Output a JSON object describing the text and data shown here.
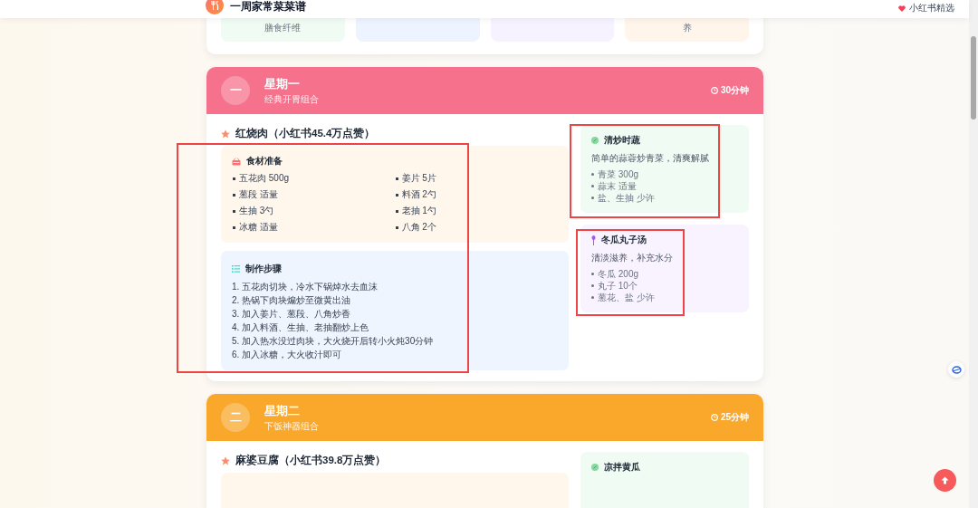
{
  "header": {
    "title": "一周家常菜菜谱",
    "badge": "小红书精选"
  },
  "summary_cards": [
    {
      "text": "膳食纤维",
      "color": "#effbf3"
    },
    {
      "color": "#eef4ff"
    },
    {
      "color": "#f7f2ff"
    },
    {
      "text": "养",
      "color": "#fff5eb"
    }
  ],
  "days": [
    {
      "badge": "一",
      "title": "星期一",
      "subtitle": "经典开胃组合",
      "time": "30分钟",
      "color": "#f6728c",
      "main_dish": {
        "highlighted": true,
        "title": "红烧肉（小红书45.4万点赞）",
        "ingredients_title": "食材准备",
        "ingredients": [
          "五花肉 500g",
          "姜片 5片",
          "葱段 适量",
          "料酒 2勺",
          "生抽 3勺",
          "老抽 1勺",
          "冰糖 适量",
          "八角 2个"
        ],
        "steps_title": "制作步骤",
        "steps": [
          "1. 五花肉切块，冷水下锅焯水去血沫",
          "2. 热锅下肉块煸炒至微黄出油",
          "3. 加入姜片、葱段、八角炒香",
          "4. 加入料酒、生抽、老抽翻炒上色",
          "5. 加入热水没过肉块，大火烧开后转小火炖30分钟",
          "6. 加入冰糖，大火收汁即可"
        ]
      },
      "side_dishes": [
        {
          "kind": "vegetable",
          "name": "清炒时蔬",
          "description": "简单的蒜蓉炒青菜，清爽解腻",
          "items": [
            "青菜 300g",
            "蒜末 适量",
            "盐、生抽 少许"
          ],
          "highlighted": true
        },
        {
          "kind": "soup",
          "name": "冬瓜丸子汤",
          "description": "清淡滋养，补充水分",
          "items": [
            "冬瓜 200g",
            "丸子 10个",
            "葱花、盐 少许"
          ],
          "highlighted": true
        }
      ]
    },
    {
      "badge": "二",
      "title": "星期二",
      "subtitle": "下饭神器组合",
      "time": "25分钟",
      "color": "#f9a82c",
      "main_dish": {
        "highlighted": false,
        "title": "麻婆豆腐（小红书39.8万点赞）"
      },
      "side_dishes": [
        {
          "kind": "vegetable",
          "name": "凉拌黄瓜",
          "highlighted": false
        }
      ]
    }
  ]
}
